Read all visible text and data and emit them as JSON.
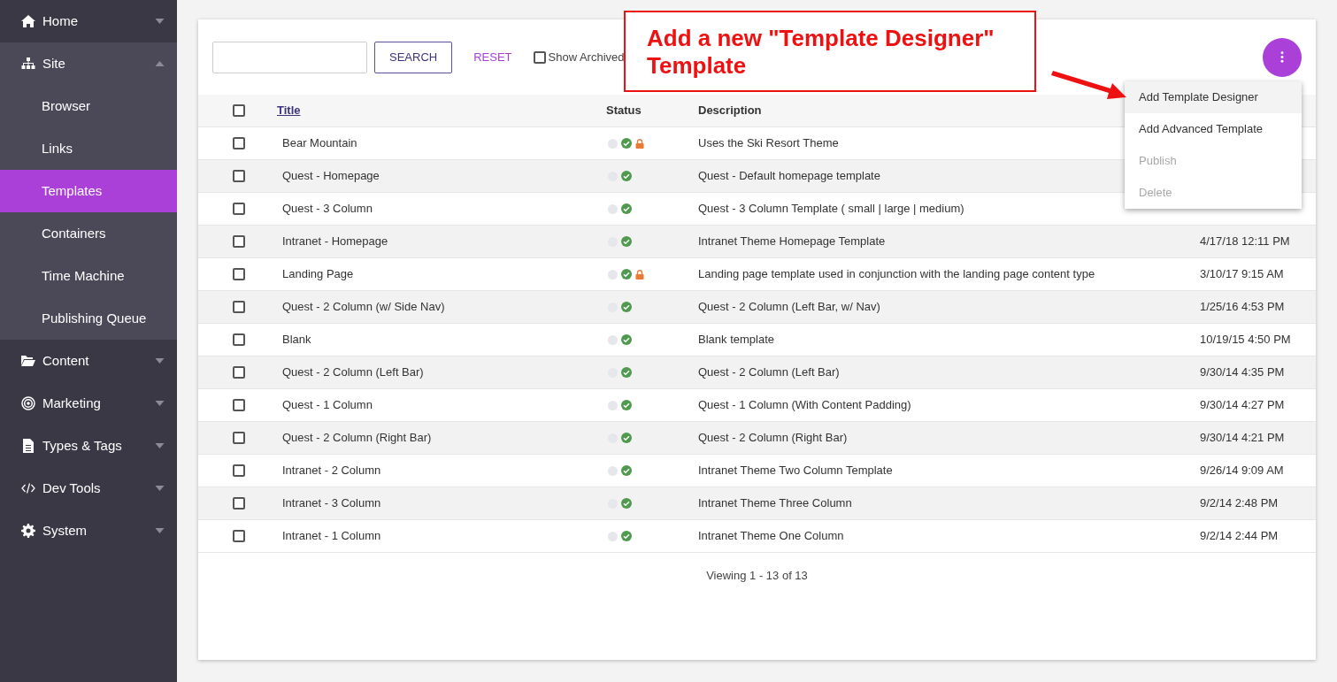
{
  "sidebar": {
    "items": [
      {
        "label": "Home",
        "expanded": false
      },
      {
        "label": "Site",
        "expanded": true,
        "children": [
          {
            "label": "Browser",
            "selected": false
          },
          {
            "label": "Links",
            "selected": false
          },
          {
            "label": "Templates",
            "selected": true
          },
          {
            "label": "Containers",
            "selected": false
          },
          {
            "label": "Time Machine",
            "selected": false
          },
          {
            "label": "Publishing Queue",
            "selected": false
          }
        ]
      },
      {
        "label": "Content",
        "expanded": false
      },
      {
        "label": "Marketing",
        "expanded": false
      },
      {
        "label": "Types & Tags",
        "expanded": false
      },
      {
        "label": "Dev Tools",
        "expanded": false
      },
      {
        "label": "System",
        "expanded": false
      }
    ]
  },
  "toolbar": {
    "search_button": "SEARCH",
    "reset_button": "RESET",
    "show_archived": {
      "label": "Show Archived",
      "checked": false
    }
  },
  "table": {
    "select_all_checked": false,
    "columns": [
      "Title",
      "Status",
      "Description"
    ],
    "rows": [
      {
        "checked": false,
        "title": "Bear Mountain",
        "staged": false,
        "live": true,
        "locked": true,
        "description": "Uses the Ski Resort Theme"
      },
      {
        "checked": false,
        "title": "Quest - Homepage",
        "staged": false,
        "live": true,
        "locked": false,
        "description": "Quest - Default homepage template"
      },
      {
        "checked": false,
        "title": "Quest - 3 Column",
        "staged": false,
        "live": true,
        "locked": false,
        "description": "Quest - 3 Column Template ( small | large | medium)"
      },
      {
        "checked": false,
        "title": "Intranet - Homepage",
        "staged": false,
        "live": true,
        "locked": false,
        "description": "Intranet Theme Homepage Template",
        "date": "4/17/18 12:11 PM"
      },
      {
        "checked": false,
        "title": "Landing Page",
        "staged": false,
        "live": true,
        "locked": true,
        "description": "Landing page template used in conjunction with the landing page content type",
        "date": "3/10/17 9:15 AM"
      },
      {
        "checked": false,
        "title": "Quest - 2 Column (w/ Side Nav)",
        "staged": false,
        "live": true,
        "locked": false,
        "description": "Quest - 2 Column (Left Bar, w/ Nav)",
        "date": "1/25/16 4:53 PM"
      },
      {
        "checked": false,
        "title": "Blank",
        "staged": false,
        "live": true,
        "locked": false,
        "description": "Blank template",
        "date": "10/19/15 4:50 PM"
      },
      {
        "checked": false,
        "title": "Quest - 2 Column (Left Bar)",
        "staged": false,
        "live": true,
        "locked": false,
        "description": "Quest - 2 Column (Left Bar)",
        "date": "9/30/14 4:35 PM"
      },
      {
        "checked": false,
        "title": "Quest - 1 Column",
        "staged": false,
        "live": true,
        "locked": false,
        "description": "Quest - 1 Column (With Content Padding)",
        "date": "9/30/14 4:27 PM"
      },
      {
        "checked": false,
        "title": "Quest - 2 Column (Right Bar)",
        "staged": false,
        "live": true,
        "locked": false,
        "description": "Quest - 2 Column (Right Bar)",
        "date": "9/30/14 4:21 PM"
      },
      {
        "checked": false,
        "title": "Intranet - 2 Column",
        "staged": false,
        "live": true,
        "locked": false,
        "description": "Intranet Theme Two Column Template",
        "date": "9/26/14 9:09 AM"
      },
      {
        "checked": false,
        "title": "Intranet - 3 Column",
        "staged": false,
        "live": true,
        "locked": false,
        "description": "Intranet Theme Three Column",
        "date": "9/2/14 2:48 PM"
      },
      {
        "checked": false,
        "title": "Intranet - 1 Column",
        "staged": false,
        "live": true,
        "locked": false,
        "description": "Intranet Theme One Column",
        "date": "9/2/14 2:44 PM"
      }
    ],
    "footer": "Viewing 1 - 13 of 13"
  },
  "menu": {
    "items": [
      {
        "label": "Add Template Designer",
        "selected": true,
        "disabled": false
      },
      {
        "label": "Add Advanced Template",
        "selected": false,
        "disabled": false
      },
      {
        "label": "Publish",
        "selected": false,
        "disabled": true
      },
      {
        "label": "Delete",
        "selected": false,
        "disabled": true
      }
    ]
  },
  "annotation": {
    "text": "Add a new \"Template Designer\" Template"
  }
}
